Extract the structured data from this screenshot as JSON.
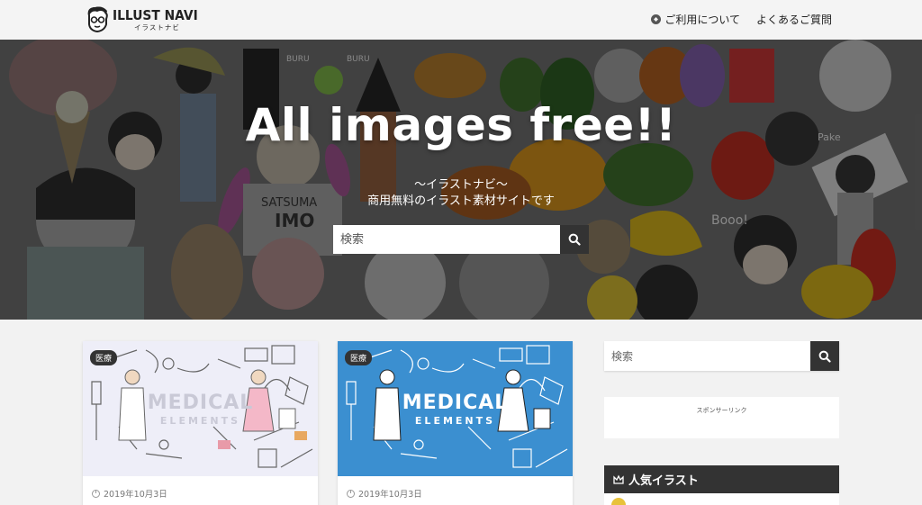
{
  "header": {
    "logo_text": "ILLUST NAVI",
    "logo_subtext": "イラストナビ",
    "nav": [
      {
        "label": "ご利用について",
        "icon": "compass-icon"
      },
      {
        "label": "よくあるご質問"
      }
    ]
  },
  "hero": {
    "title": "All images free!!",
    "subtitle1": "〜イラストナビ〜",
    "subtitle2": "商用無料のイラスト素材サイトです",
    "search_placeholder": "検索",
    "art_text": [
      "BURU",
      "BURU",
      "SATSUMA",
      "IMO",
      "Booo!",
      "Pake"
    ]
  },
  "cards": [
    {
      "badge": "医療",
      "title": "MEDICAL",
      "subtitle": "ELEMENTS",
      "date": "2019年10月3日",
      "bg": "#eeeef8",
      "text_color": "#c9c9d6"
    },
    {
      "badge": "医療",
      "title": "MEDICAL",
      "subtitle": "ELEMENTS",
      "date": "2019年10月3日",
      "bg": "#3b8fd0",
      "text_color": "#ffffff"
    }
  ],
  "sidebar": {
    "search_placeholder": "検索",
    "sponsor_label": "スポンサーリンク",
    "popular_title": "人気イラスト"
  },
  "colors": {
    "dark": "#333333",
    "header_bg": "#f4f4f4",
    "page_bg": "#f2f2f2",
    "accent_blue": "#3b8fd0",
    "rank_gold": "#e8c23a"
  }
}
